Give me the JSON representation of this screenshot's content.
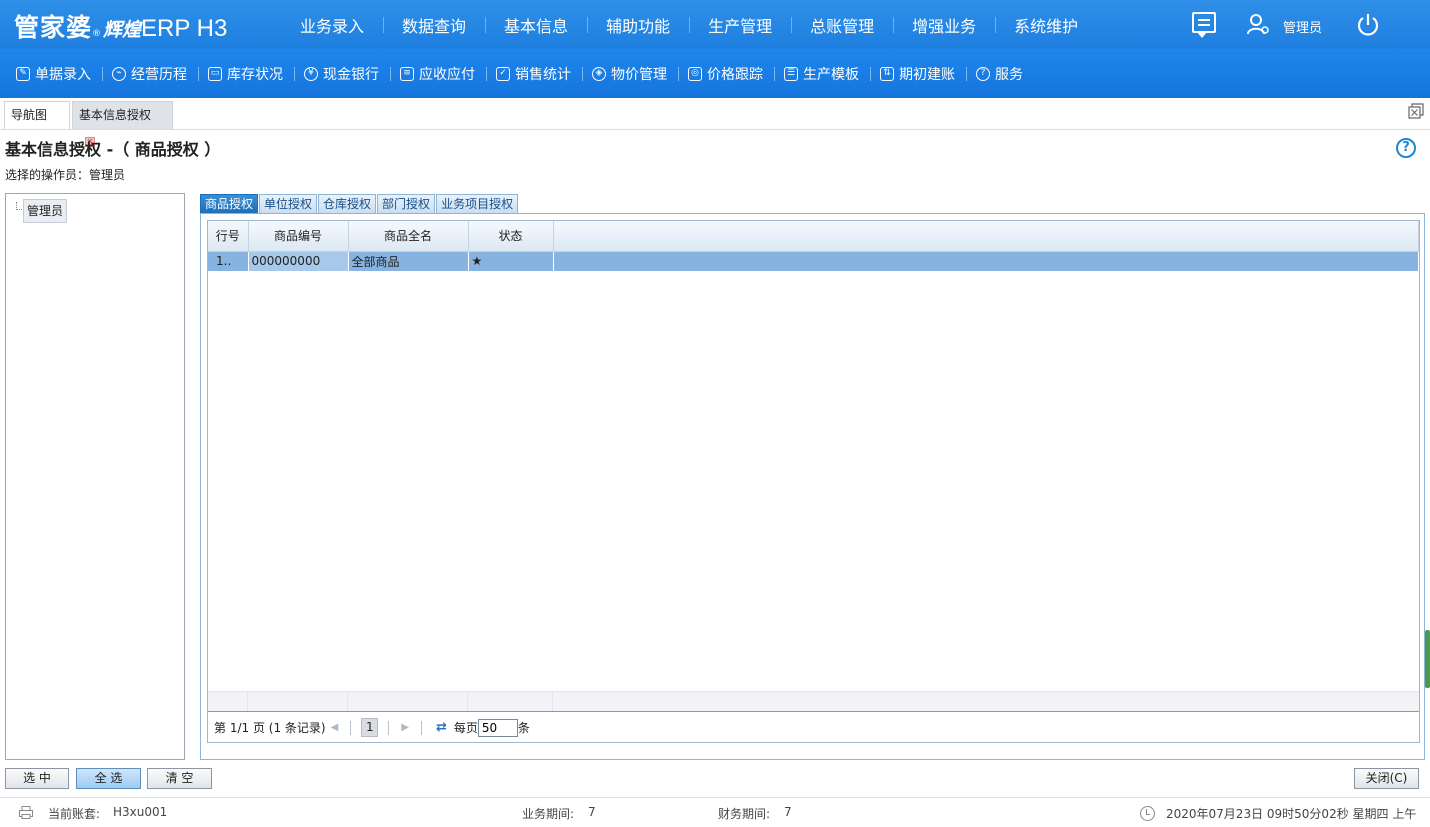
{
  "header": {
    "brand": "管家婆",
    "brand_mark": "®",
    "brand_sub": "辉煌",
    "product": "ERP H3",
    "menu": [
      "业务录入",
      "数据查询",
      "基本信息",
      "辅助功能",
      "生产管理",
      "总账管理",
      "增强业务",
      "系统维护"
    ],
    "user_label": "管理员"
  },
  "toolbar": {
    "items": [
      {
        "label": "单据录入",
        "icon": "edit-icon"
      },
      {
        "label": "经营历程",
        "icon": "chart-circle-icon"
      },
      {
        "label": "库存状况",
        "icon": "inventory-icon"
      },
      {
        "label": "现金银行",
        "icon": "yen-icon"
      },
      {
        "label": "应收应付",
        "icon": "receivable-icon"
      },
      {
        "label": "销售统计",
        "icon": "sales-stats-icon"
      },
      {
        "label": "物价管理",
        "icon": "price-shield-icon"
      },
      {
        "label": "价格跟踪",
        "icon": "price-track-icon"
      },
      {
        "label": "生产模板",
        "icon": "template-icon"
      },
      {
        "label": "期初建账",
        "icon": "opening-account-icon"
      },
      {
        "label": "服务",
        "icon": "help-circle-icon"
      }
    ]
  },
  "page_tabs": [
    {
      "label": "导航图",
      "active": false
    },
    {
      "label": "基本信息授权",
      "active": true
    }
  ],
  "page": {
    "title": "基本信息授权 -（ 商品授权 ）",
    "operator_label": "选择的操作员：",
    "operator_value": "管理员"
  },
  "tree": {
    "root": "管理员"
  },
  "subtabs": [
    "商品授权",
    "单位授权",
    "仓库授权",
    "部门授权",
    "业务项目授权"
  ],
  "grid": {
    "columns": [
      "行号",
      "商品编号",
      "商品全名",
      "状态"
    ],
    "rows": [
      {
        "no": "1..",
        "code": "000000000",
        "name": "全部商品",
        "status": "★"
      }
    ]
  },
  "pager": {
    "info": "第 1/1 页 (1 条记录)",
    "current_page": "1",
    "per_page_label": "每页",
    "per_page_value": "50",
    "per_page_unit": "条"
  },
  "buttons": {
    "select": "选 中",
    "select_all": "全 选",
    "clear": "清 空",
    "close": "关闭(C)"
  },
  "status": {
    "account_label": "当前账套:",
    "account_value": "H3xu001",
    "biz_period_label": "业务期间:",
    "biz_period_value": "7",
    "fin_period_label": "财务期间:",
    "fin_period_value": "7",
    "datetime": "2020年07月23日 09时50分02秒 星期四 上午"
  },
  "colors": {
    "header_bg": "#1e7fe0",
    "toolbar_bg": "#1575dd",
    "selected_row": "#86b3e0",
    "active_subtab": "#1b6fba"
  }
}
